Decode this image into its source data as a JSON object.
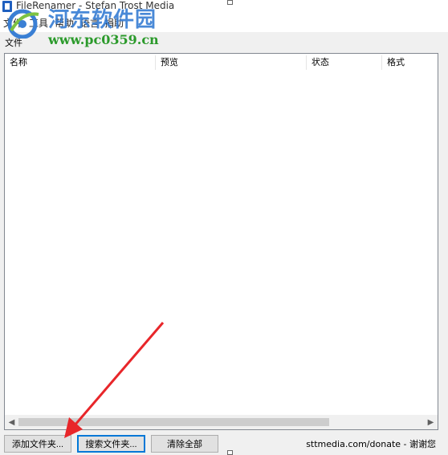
{
  "window": {
    "title": "FileRenamer - Stefan Trost Media"
  },
  "menu": {
    "items": [
      "文件",
      "工具",
      "帮助",
      "语言",
      "捐助"
    ]
  },
  "watermark": {
    "title": "河东软件园",
    "url": "www.pc0359.cn"
  },
  "tab": {
    "label": "文件"
  },
  "list": {
    "columns": [
      "名称",
      "预览",
      "状态",
      "格式"
    ],
    "rows": []
  },
  "scrollbar": {
    "left_icon": "chevron-left-icon",
    "right_icon": "chevron-right-icon"
  },
  "buttons": {
    "add_folder": "添加文件夹...",
    "search_folder": "搜索文件夹...",
    "clear_all": "清除全部"
  },
  "footer": {
    "donate": "sttmedia.com/donate - 谢谢您"
  },
  "colors": {
    "accent": "#0078d7",
    "annotation_arrow": "#e8262a",
    "watermark_blue": "#3a7fd4",
    "watermark_green": "#2b9a2b"
  }
}
